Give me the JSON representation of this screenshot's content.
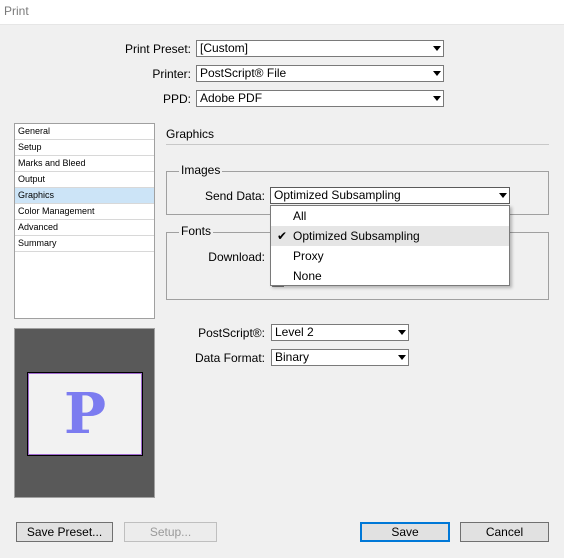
{
  "window": {
    "title": "Print"
  },
  "top_fields": {
    "print_preset": {
      "label": "Print Preset:",
      "value": "[Custom]"
    },
    "printer": {
      "label": "Printer:",
      "value": "PostScript® File"
    },
    "ppd": {
      "label": "PPD:",
      "value": "Adobe PDF"
    }
  },
  "sidebar": {
    "items": [
      {
        "label": "General"
      },
      {
        "label": "Setup"
      },
      {
        "label": "Marks and Bleed"
      },
      {
        "label": "Output"
      },
      {
        "label": "Graphics"
      },
      {
        "label": "Color Management"
      },
      {
        "label": "Advanced"
      },
      {
        "label": "Summary"
      }
    ],
    "selected": "Graphics"
  },
  "preview": {
    "letter": "P"
  },
  "main": {
    "section_title": "Graphics",
    "images": {
      "legend": "Images",
      "send_data_label": "Send Data:",
      "send_data_value": "Optimized Subsampling"
    },
    "fonts": {
      "legend": "Fonts",
      "download_label": "Download:"
    },
    "send_data_menu": {
      "options": [
        {
          "label": "All",
          "checked": false
        },
        {
          "label": "Optimized Subsampling",
          "checked": true
        },
        {
          "label": "Proxy",
          "checked": false
        },
        {
          "label": "None",
          "checked": false
        }
      ],
      "check_glyph": "✔"
    },
    "postscript": {
      "label": "PostScript®:",
      "value": "Level 2"
    },
    "data_format": {
      "label": "Data Format:",
      "value": "Binary"
    }
  },
  "buttons": {
    "save_preset": "Save Preset...",
    "setup": "Setup...",
    "save": "Save",
    "cancel": "Cancel"
  }
}
